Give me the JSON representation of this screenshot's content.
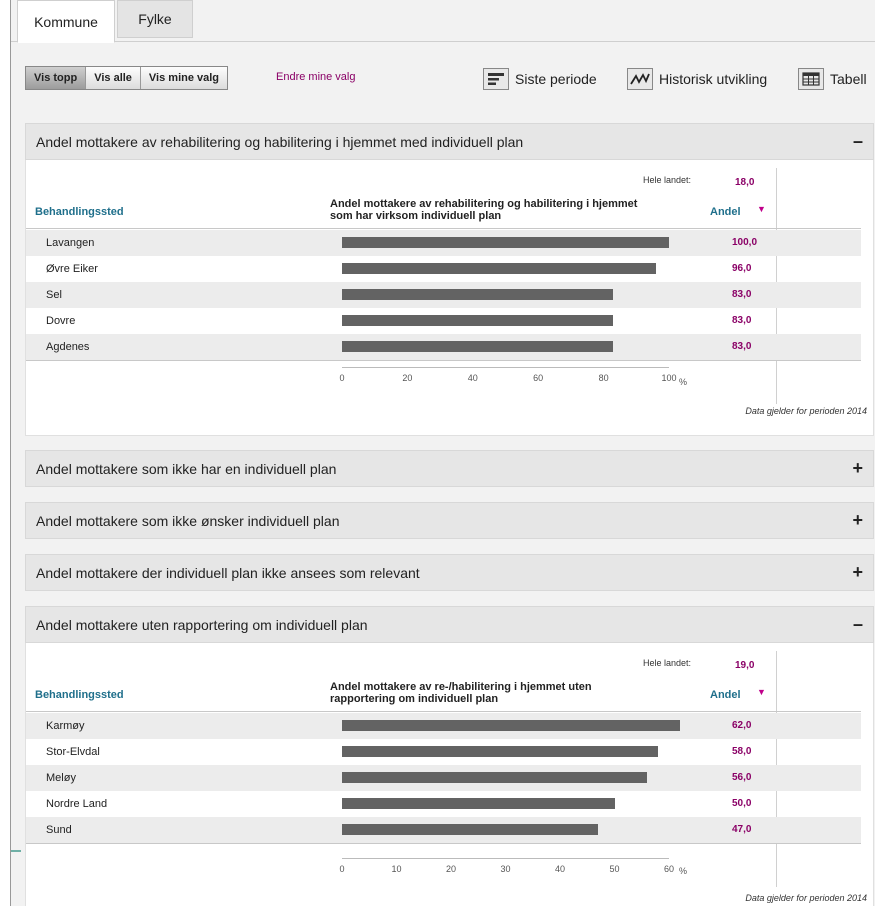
{
  "tabs": [
    "Kommune",
    "Fylke"
  ],
  "toolbar": {
    "segments": [
      "Vis topp",
      "Vis alle",
      "Vis mine valg"
    ],
    "edit_link": "Endre mine valg",
    "views": [
      {
        "label": "Siste periode",
        "icon": "bar-list-icon"
      },
      {
        "label": "Historisk utvikling",
        "icon": "trend-line-icon"
      },
      {
        "label": "Tabell",
        "icon": "table-icon"
      }
    ]
  },
  "panels": [
    {
      "title": "Andel mottakere av rehabilitering og habilitering i hjemmet med individuell plan",
      "toggle": "–",
      "expanded": true,
      "hele_label": "Hele landet:",
      "hele_value": "18,0",
      "col_left": "Behandlingssted",
      "col_mid": "Andel mottakere av rehabilitering og habilitering i hjemmet som har virksom individuell plan",
      "col_right": "Andel",
      "sort_icon": "▼",
      "pct_label": "%",
      "note": "Data gjelder for perioden  2014",
      "chart_data": {
        "type": "bar",
        "categories": [
          "Lavangen",
          "Øvre Eiker",
          "Sel",
          "Dovre",
          "Agdenes"
        ],
        "values": [
          100.0,
          96.0,
          83.0,
          83.0,
          83.0
        ],
        "value_labels": [
          "100,0",
          "96,0",
          "83,0",
          "83,0",
          "83,0"
        ],
        "xlim": [
          0,
          100
        ],
        "ticks": [
          "0",
          "20",
          "40",
          "60",
          "80",
          "100"
        ]
      }
    },
    {
      "title": "Andel mottakere som ikke har en individuell plan",
      "toggle": "+",
      "expanded": false
    },
    {
      "title": "Andel mottakere som ikke ønsker individuell plan",
      "toggle": "+",
      "expanded": false
    },
    {
      "title": "Andel mottakere der individuell plan ikke ansees som relevant",
      "toggle": "+",
      "expanded": false
    },
    {
      "title": "Andel mottakere uten rapportering om individuell plan",
      "toggle": "–",
      "expanded": true,
      "hele_label": "Hele landet:",
      "hele_value": "19,0",
      "col_left": "Behandlingssted",
      "col_mid": "Andel mottakere av re-/habilitering i hjemmet uten rapportering om individuell plan",
      "col_right": "Andel",
      "sort_icon": "▼",
      "pct_label": "%",
      "note": "Data gjelder for perioden  2014",
      "chart_data": {
        "type": "bar",
        "categories": [
          "Karmøy",
          "Stor-Elvdal",
          "Meløy",
          "Nordre Land",
          "Sund"
        ],
        "values": [
          62.0,
          58.0,
          56.0,
          50.0,
          47.0
        ],
        "value_labels": [
          "62,0",
          "58,0",
          "56,0",
          "50,0",
          "47,0"
        ],
        "xlim": [
          0,
          60
        ],
        "ticks": [
          "0",
          "10",
          "20",
          "30",
          "40",
          "50",
          "60"
        ]
      }
    }
  ]
}
